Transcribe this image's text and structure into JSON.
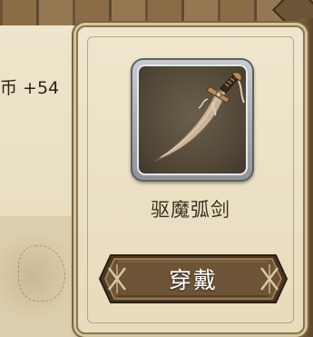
{
  "hud": {
    "currency_text": "币 +54"
  },
  "item_popup": {
    "item_icon": "curved-saber-icon",
    "item_name": "驱魔弧剑",
    "equip_button_label": "穿戴"
  },
  "colors": {
    "parchment": "#efe6cd",
    "wood_button": "#6e5436",
    "slot_frame": "#b7babd",
    "slot_bg": "#514636",
    "text_dark": "#3b3020"
  }
}
